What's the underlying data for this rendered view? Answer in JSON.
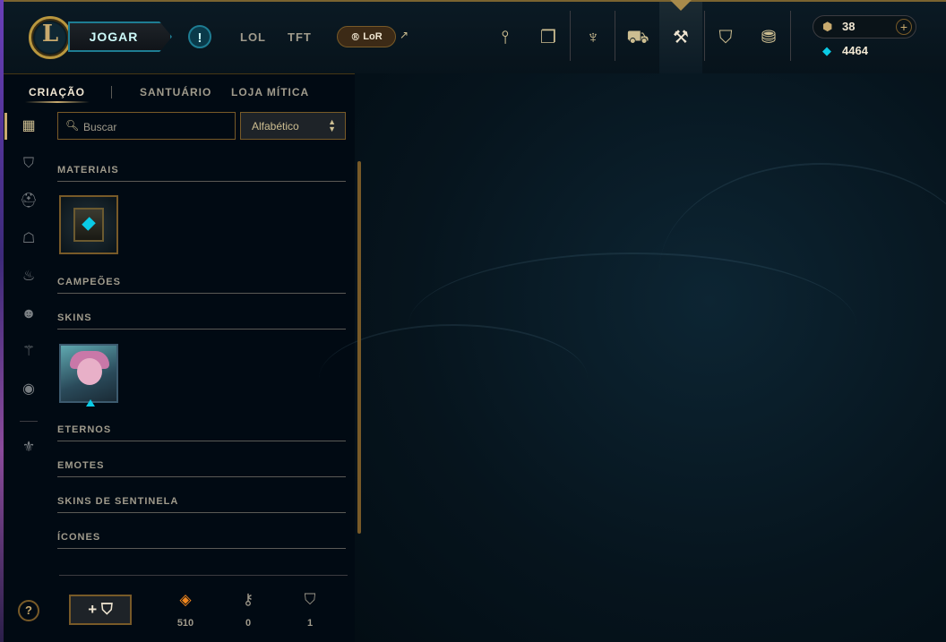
{
  "header": {
    "logo_letter": "L",
    "play_label": "JOGAR",
    "alert_label": "!",
    "game_tabs": [
      "LOL",
      "TFT"
    ],
    "lor_label": "LoR",
    "lor_link_icon": "external-link-icon",
    "nav_icons": [
      "home-trident-icon",
      "tft-cards-icon",
      "profile-laurel-icon",
      "inventory-bag-icon",
      "loot-crafting-icon",
      "collection-shield-icon",
      "store-coins-icon"
    ],
    "active_nav": "loot-crafting-icon"
  },
  "currency": {
    "rp_value": "38",
    "rp_add": "+",
    "be_value": "4464"
  },
  "subtabs": {
    "crafting": "CRIAÇÃO",
    "sanctuary": "SANTUÁRIO",
    "mythic_shop": "LOJA MÍTICA"
  },
  "filters": [
    "all-grid-icon",
    "chest-icon",
    "champion-helmet-icon",
    "skin-mask-icon",
    "ward-flame-icon",
    "emote-face-icon",
    "eternals-icon",
    "summoner-icon-icon",
    "other-icon"
  ],
  "search": {
    "placeholder": "Buscar"
  },
  "sort": {
    "selected": "Alfabético"
  },
  "sections": {
    "materials": "MATERIAIS",
    "champions": "CAMPEÕES",
    "skins": "SKINS",
    "eternals": "ETERNOS",
    "emotes": "EMOTES",
    "wards": "SKINS DE SENTINELA",
    "icons": "ÍCONES"
  },
  "footer": {
    "help_label": "?",
    "add_chest_label": "+ ⛉",
    "counters": [
      {
        "icon": "orange-essence-icon",
        "value": "510"
      },
      {
        "icon": "key-fragment-icon",
        "value": "0"
      },
      {
        "icon": "chest-count-icon",
        "value": "1"
      }
    ]
  },
  "colors": {
    "gold": "#c8aa6e",
    "blue_essence": "#0acbe6",
    "orange_essence": "#f0861e",
    "background": "#010a13"
  }
}
